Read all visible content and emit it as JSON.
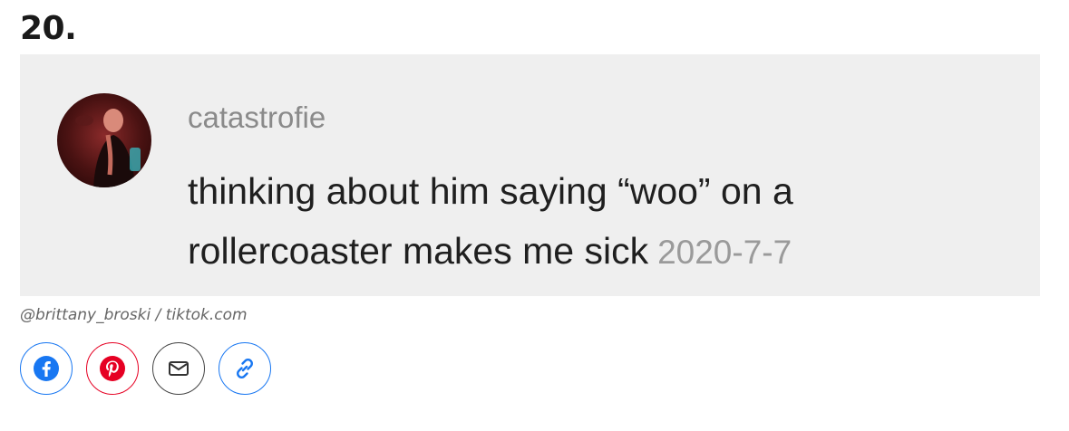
{
  "item": {
    "number": "20."
  },
  "comment": {
    "username": "catastrofie",
    "text": "thinking about him saying “woo” on a rollercoaster makes me sick",
    "date": "2020-7-7",
    "avatar_icon": "profile-photo"
  },
  "credit": "@brittany_broski / tiktok.com",
  "share": {
    "buttons": [
      {
        "name": "facebook",
        "icon": "facebook-icon",
        "color": "#1877f2"
      },
      {
        "name": "pinterest",
        "icon": "pinterest-icon",
        "color": "#e60023"
      },
      {
        "name": "email",
        "icon": "envelope-icon",
        "color": "#444444"
      },
      {
        "name": "copy-link",
        "icon": "link-icon",
        "color": "#1877f2"
      }
    ]
  }
}
